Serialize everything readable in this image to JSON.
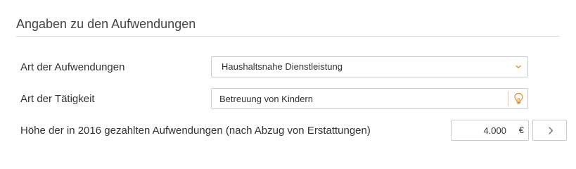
{
  "section": {
    "title": "Angaben zu den Aufwendungen"
  },
  "form": {
    "expense_type": {
      "label": "Art der Aufwendungen",
      "value": "Haushaltsnahe Dienstleistung",
      "icon": "chevron-down-icon"
    },
    "activity_type": {
      "label": "Art der Tätigkeit",
      "value": "Betreuung von Kindern",
      "icon": "lightbulb-icon"
    },
    "amount": {
      "label": "Höhe der in 2016 gezahlten Aufwendungen (nach Abzug von Erstattungen)",
      "value": "4.000",
      "currency": "€",
      "next_icon": "chevron-right-icon"
    }
  },
  "colors": {
    "divider": "#e4d6c8",
    "accent_icon": "#e0903a",
    "border": "#cccccc",
    "text": "#333333"
  }
}
